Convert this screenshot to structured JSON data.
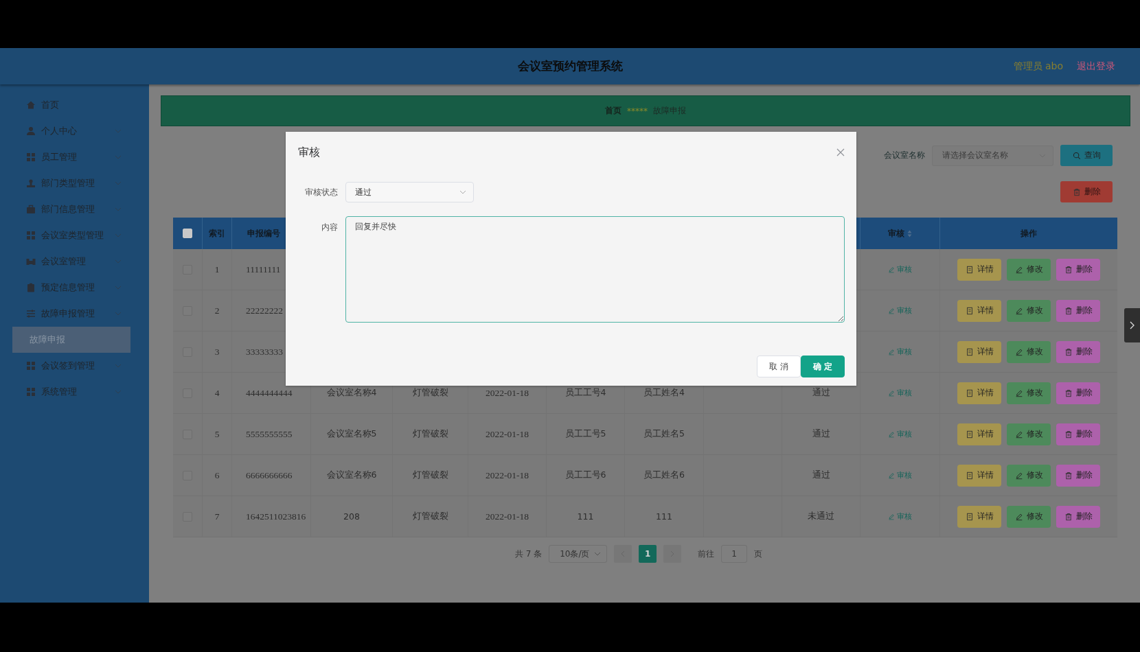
{
  "header": {
    "title": "会议室预约管理系统",
    "user": "管理员 abo",
    "logout": "退出登录"
  },
  "sidebar": {
    "items": [
      {
        "label": "首页",
        "selected": false,
        "expandable": false
      },
      {
        "label": "个人中心",
        "selected": false,
        "expandable": true
      },
      {
        "label": "员工管理",
        "selected": false,
        "expandable": true
      },
      {
        "label": "部门类型管理",
        "selected": false,
        "expandable": true
      },
      {
        "label": "部门信息管理",
        "selected": false,
        "expandable": true
      },
      {
        "label": "会议室类型管理",
        "selected": false,
        "expandable": true
      },
      {
        "label": "会议室管理",
        "selected": false,
        "expandable": true
      },
      {
        "label": "预定信息管理",
        "selected": false,
        "expandable": true
      },
      {
        "label": "故障申报管理",
        "selected": false,
        "expandable": true,
        "children": [
          {
            "label": "故障申报",
            "selected": true
          }
        ]
      },
      {
        "label": "会议签到管理",
        "selected": false,
        "expandable": true
      },
      {
        "label": "系统管理",
        "selected": false,
        "expandable": true
      }
    ]
  },
  "breadcrumb": {
    "items": [
      "首页",
      "故障申报"
    ],
    "separator": "*****"
  },
  "search": {
    "label": "会议室名称",
    "placeholder": "请选择会议室名称",
    "button": "查询"
  },
  "delete_button": "删除",
  "table": {
    "header": {
      "checked": false,
      "index": "索引",
      "report_no": "申报编号",
      "audit": "审核",
      "actions": "操作"
    },
    "rows": [
      {
        "checked": false,
        "index": "1",
        "report_no": "11111111",
        "audit_link": "审核",
        "actions": [
          {
            "label": "详情",
            "kind": "detail"
          },
          {
            "label": "修改",
            "kind": "edit"
          },
          {
            "label": "删除",
            "kind": "delete"
          }
        ]
      },
      {
        "checked": false,
        "index": "2",
        "report_no": "22222222",
        "audit_link": "审核",
        "actions": [
          {
            "label": "详情",
            "kind": "detail"
          },
          {
            "label": "修改",
            "kind": "edit"
          },
          {
            "label": "删除",
            "kind": "delete"
          }
        ]
      },
      {
        "checked": false,
        "index": "3",
        "report_no": "33333333",
        "audit_link": "审核",
        "actions": [
          {
            "label": "详情",
            "kind": "detail"
          },
          {
            "label": "修改",
            "kind": "edit"
          },
          {
            "label": "删除",
            "kind": "delete"
          }
        ]
      },
      {
        "checked": false,
        "index": "4",
        "report_no": "4444444444",
        "room": "会议室名称4",
        "fault": "灯管破裂",
        "date": "2022-01-18",
        "emp_no": "员工工号4",
        "emp_name": "员工姓名4",
        "status": "通过",
        "audit_link": "审核",
        "actions": [
          {
            "label": "详情",
            "kind": "detail"
          },
          {
            "label": "修改",
            "kind": "edit"
          },
          {
            "label": "删除",
            "kind": "delete"
          }
        ]
      },
      {
        "checked": false,
        "index": "5",
        "report_no": "5555555555",
        "room": "会议室名称5",
        "fault": "灯管破裂",
        "date": "2022-01-18",
        "emp_no": "员工工号5",
        "emp_name": "员工姓名5",
        "status": "通过",
        "audit_link": "审核",
        "actions": [
          {
            "label": "详情",
            "kind": "detail"
          },
          {
            "label": "修改",
            "kind": "edit"
          },
          {
            "label": "删除",
            "kind": "delete"
          }
        ]
      },
      {
        "checked": false,
        "index": "6",
        "report_no": "6666666666",
        "room": "会议室名称6",
        "fault": "灯管破裂",
        "date": "2022-01-18",
        "emp_no": "员工工号6",
        "emp_name": "员工姓名6",
        "status": "通过",
        "audit_link": "审核",
        "actions": [
          {
            "label": "详情",
            "kind": "detail"
          },
          {
            "label": "修改",
            "kind": "edit"
          },
          {
            "label": "删除",
            "kind": "delete"
          }
        ]
      },
      {
        "checked": false,
        "index": "7",
        "report_no": "1642511023816",
        "room": "208",
        "fault": "灯管破裂",
        "date": "2022-01-18",
        "emp_no": "111",
        "emp_name": "111",
        "status": "未通过",
        "audit_link": "审核",
        "actions": [
          {
            "label": "详情",
            "kind": "detail"
          },
          {
            "label": "修改",
            "kind": "edit"
          },
          {
            "label": "删除",
            "kind": "delete"
          }
        ]
      }
    ]
  },
  "pagination": {
    "total": "共 7 条",
    "page_size": "10条/页",
    "pages": [
      {
        "label": "1",
        "selected": true
      }
    ],
    "goto_label": "前往",
    "goto_value": "1",
    "goto_suffix": "页"
  },
  "dialog": {
    "title": "审核",
    "fields": [
      {
        "kind": "select",
        "label": "审核状态",
        "value": "通过"
      },
      {
        "kind": "textarea",
        "label": "内容",
        "value": "回复并尽快"
      }
    ],
    "buttons": [
      {
        "label": "取 消",
        "kind": "default"
      },
      {
        "label": "确 定",
        "kind": "primary"
      }
    ]
  }
}
